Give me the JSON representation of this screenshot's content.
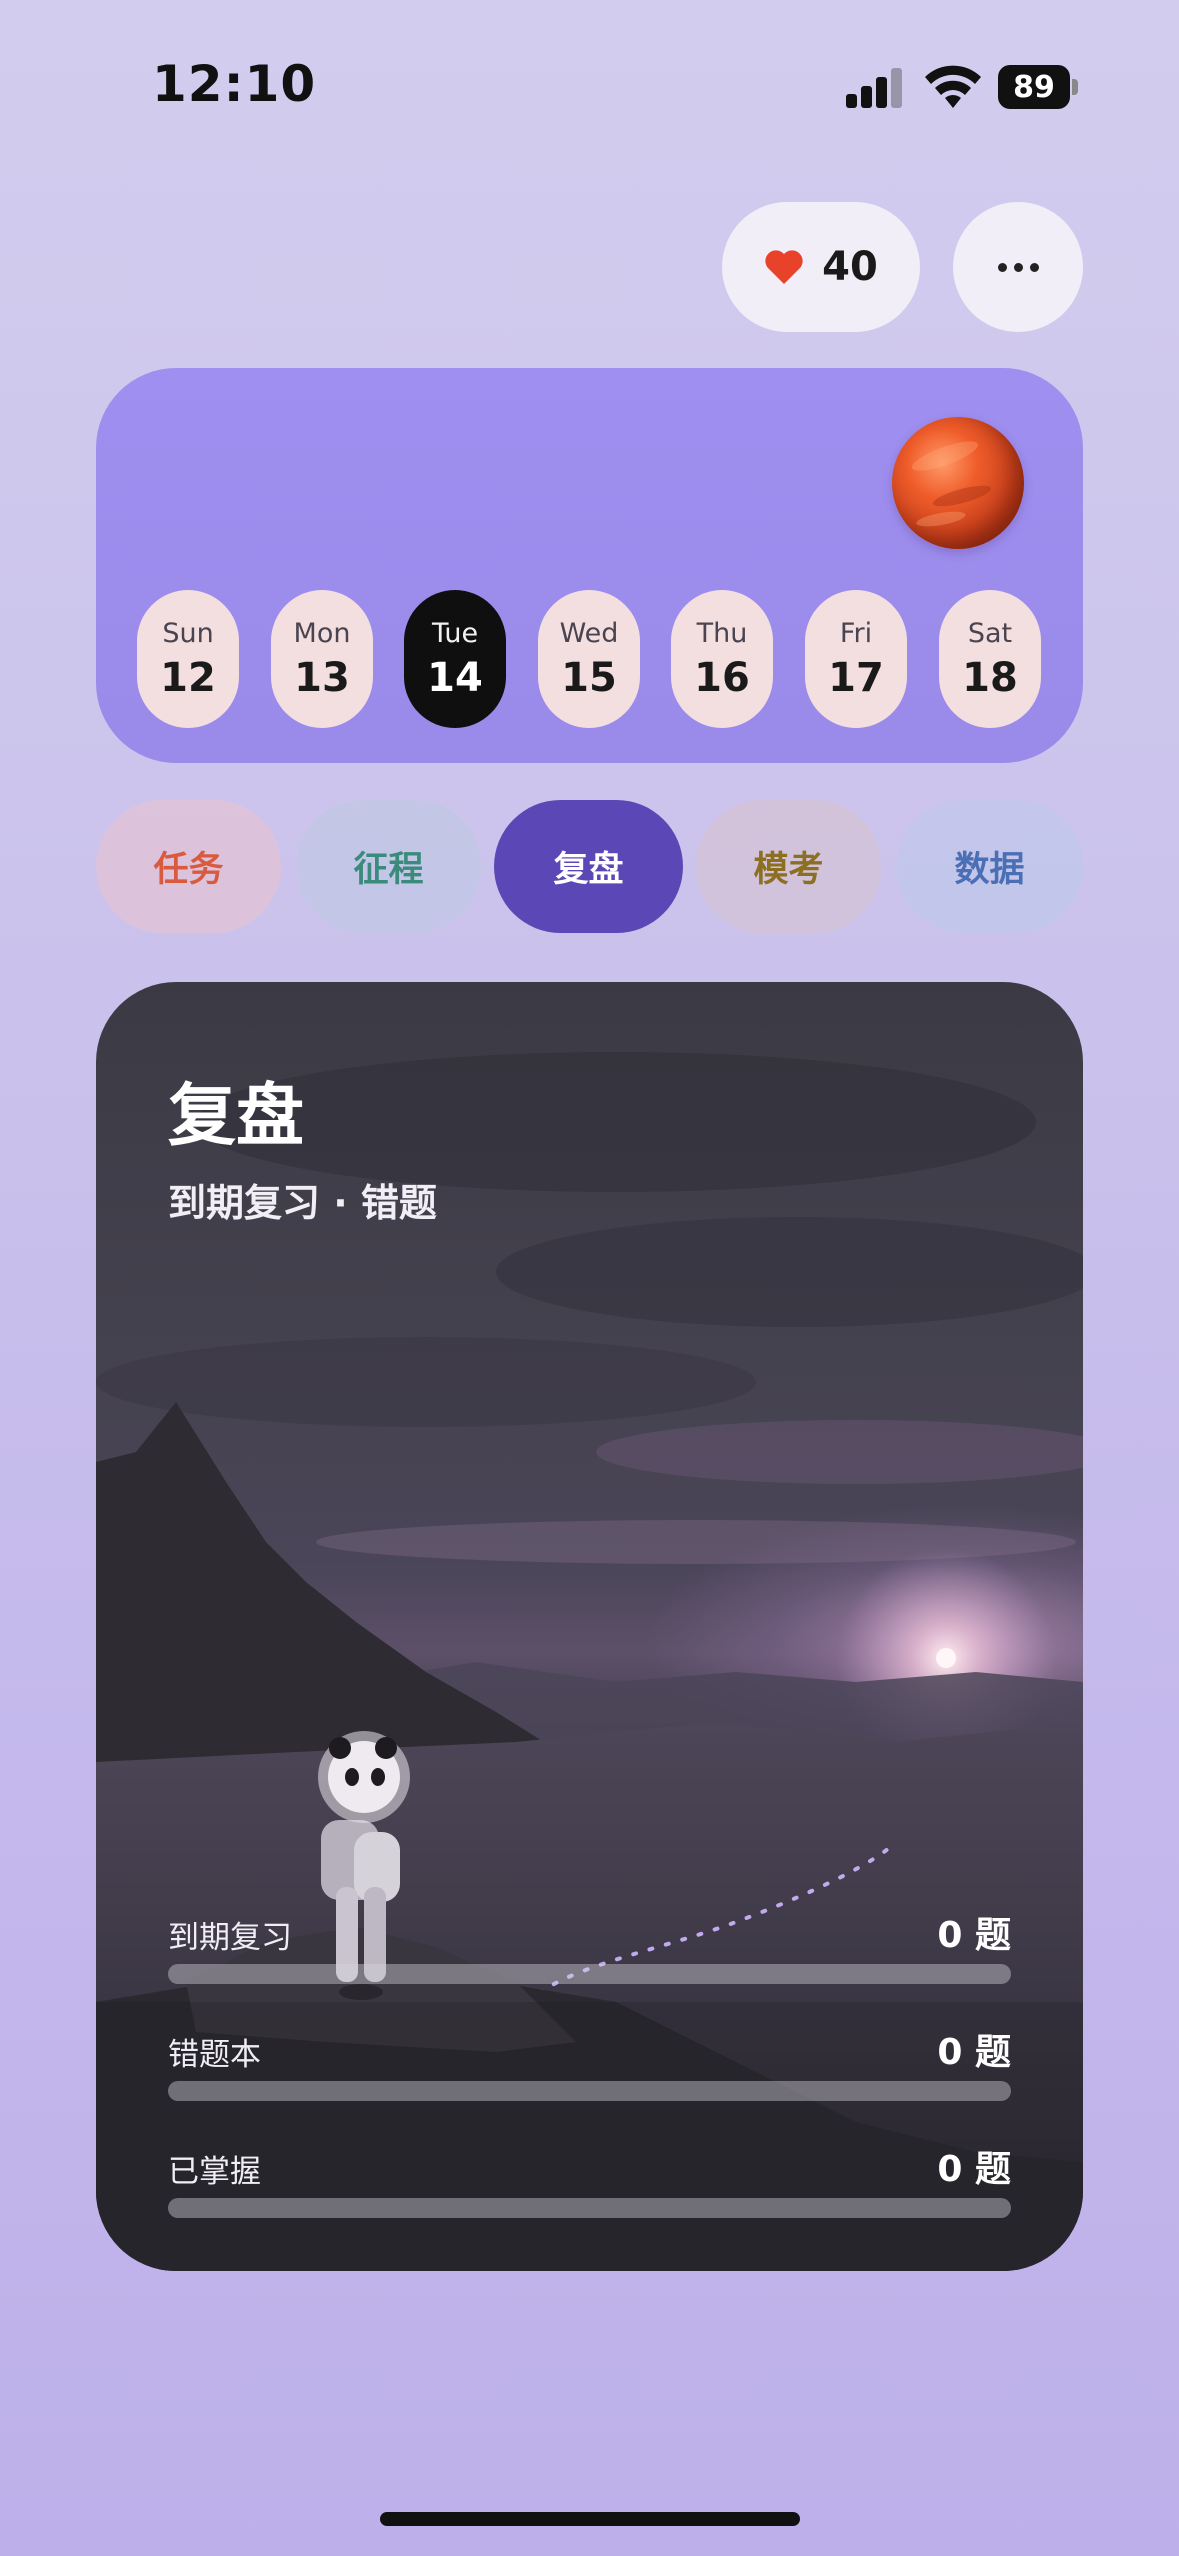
{
  "status_bar": {
    "time": "12:10",
    "battery": "89"
  },
  "likes": {
    "count": "40"
  },
  "week": {
    "days": [
      {
        "name": "Sun",
        "num": "12"
      },
      {
        "name": "Mon",
        "num": "13"
      },
      {
        "name": "Tue",
        "num": "14"
      },
      {
        "name": "Wed",
        "num": "15"
      },
      {
        "name": "Thu",
        "num": "16"
      },
      {
        "name": "Fri",
        "num": "17"
      },
      {
        "name": "Sat",
        "num": "18"
      }
    ],
    "selected_day": "Tue"
  },
  "tabs": [
    {
      "label": "任务"
    },
    {
      "label": "征程"
    },
    {
      "label": "复盘"
    },
    {
      "label": "模考"
    },
    {
      "label": "数据"
    }
  ],
  "active_tab": "复盘",
  "review": {
    "title": "复盘",
    "subtitle": "到期复习 · 错题",
    "stats": [
      {
        "label": "到期复习",
        "value": "0 题",
        "progress": 0
      },
      {
        "label": "错题本",
        "value": "0 题",
        "progress": 0
      },
      {
        "label": "已掌握",
        "value": "0 题",
        "progress": 0
      }
    ]
  },
  "colors": {
    "accent": "#5b47b6",
    "week_card": "#9e8ff0",
    "heart": "#e8432a"
  }
}
